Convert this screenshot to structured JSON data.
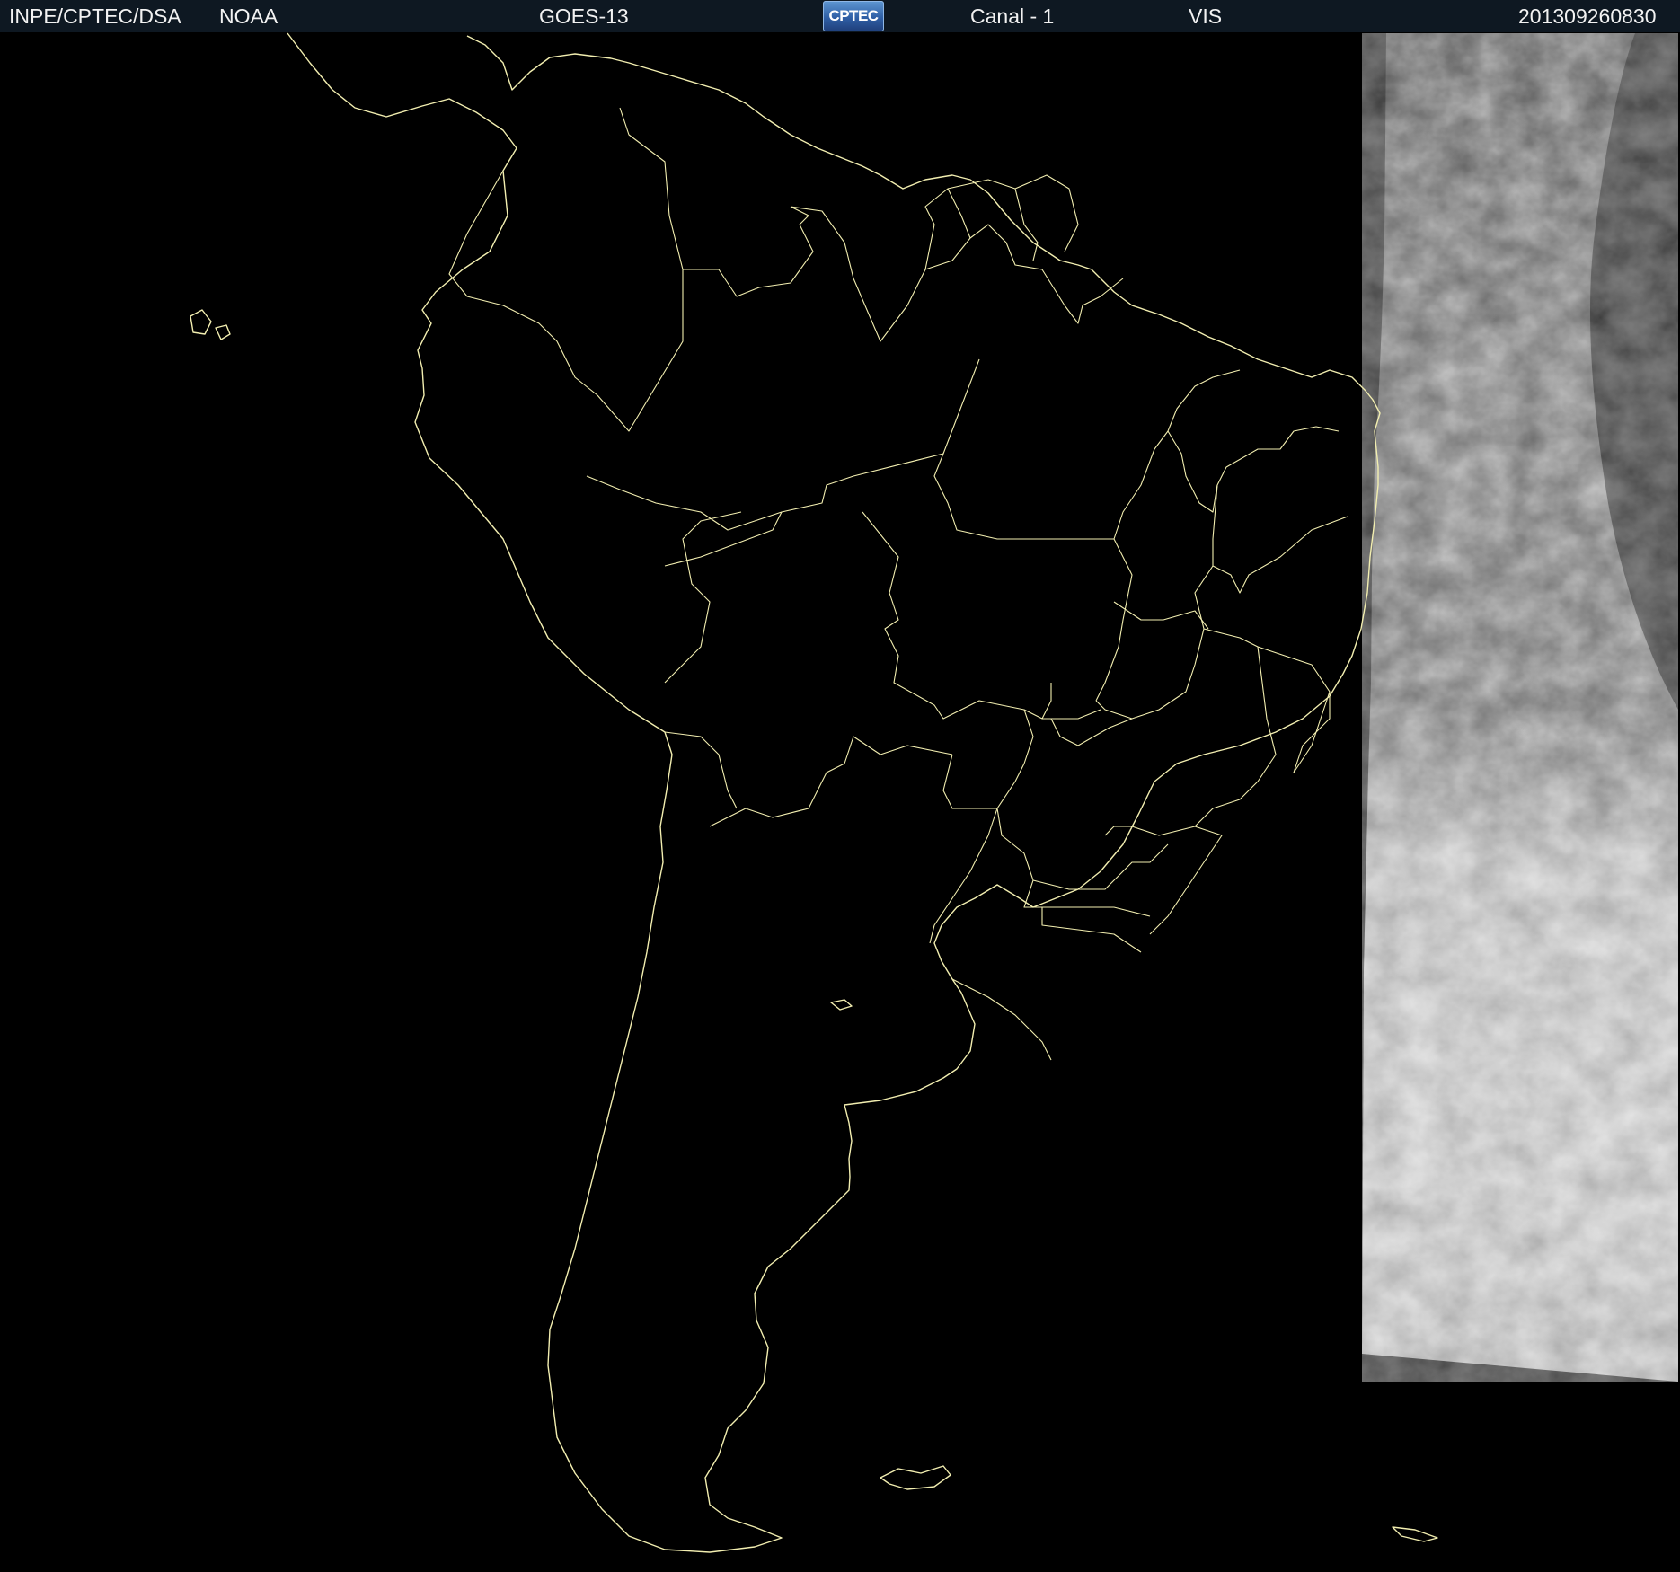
{
  "header": {
    "org": "INPE/CPTEC/DSA",
    "agency": "NOAA",
    "satellite": "GOES-13",
    "logo_text": "CPTEC",
    "channel": "Canal - 1",
    "band": "VIS",
    "timestamp": "201309260830"
  },
  "map": {
    "background_color": "#000000",
    "border_color": "#f2eeb0",
    "cloud_color": "#d9d9d9"
  }
}
